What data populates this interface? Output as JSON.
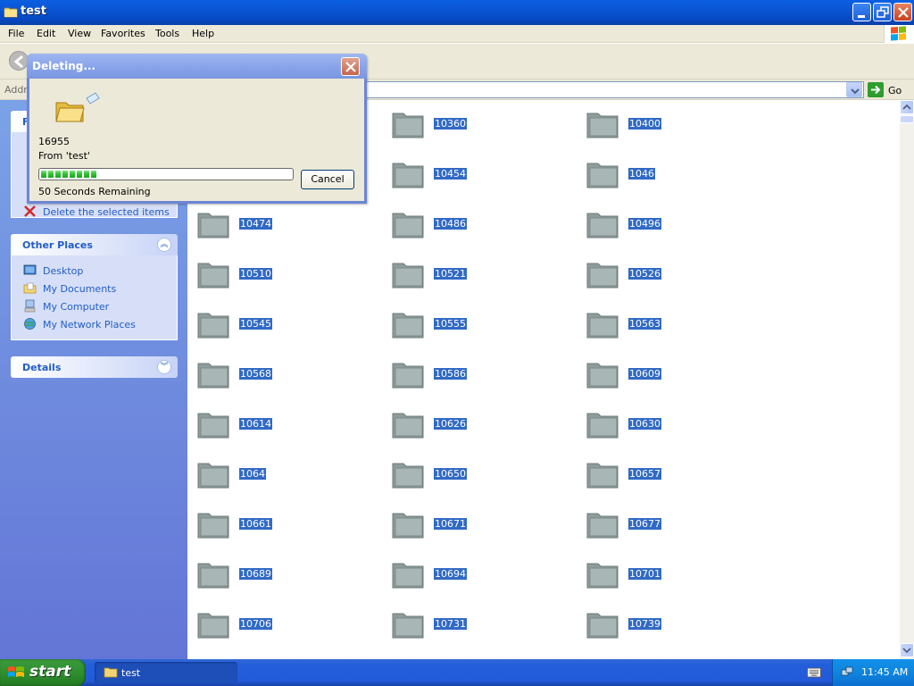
{
  "window": {
    "title": "test",
    "buttons": [
      "minimize",
      "maximize",
      "close"
    ]
  },
  "menu": {
    "items": [
      "File",
      "Edit",
      "View",
      "Favorites",
      "Tools",
      "Help"
    ]
  },
  "address": {
    "label": "Addre",
    "go_label": "Go"
  },
  "task_pane": {
    "file_tasks_partial": {
      "header_partial": "F",
      "hidden_item": "Delete the selected items"
    },
    "other_places": {
      "header": "Other Places",
      "items": [
        {
          "label": "Desktop",
          "icon": "desktop-icon"
        },
        {
          "label": "My Documents",
          "icon": "my-documents-icon"
        },
        {
          "label": "My Computer",
          "icon": "my-computer-icon"
        },
        {
          "label": "My Network Places",
          "icon": "network-places-icon"
        }
      ]
    },
    "details": {
      "header": "Details"
    }
  },
  "files": {
    "items": [
      {
        "name": "10360"
      },
      {
        "name": "10400"
      },
      {
        "name": "10454"
      },
      {
        "name": "1046"
      },
      {
        "name": "10474"
      },
      {
        "name": "10486"
      },
      {
        "name": "10496"
      },
      {
        "name": "10510"
      },
      {
        "name": "10521"
      },
      {
        "name": "10526"
      },
      {
        "name": "10545"
      },
      {
        "name": "10555"
      },
      {
        "name": "10563"
      },
      {
        "name": "10568"
      },
      {
        "name": "10586"
      },
      {
        "name": "10609"
      },
      {
        "name": "10614"
      },
      {
        "name": "10626"
      },
      {
        "name": "10630"
      },
      {
        "name": "1064"
      },
      {
        "name": "10650"
      },
      {
        "name": "10657"
      },
      {
        "name": "10661"
      },
      {
        "name": "10671"
      },
      {
        "name": "10677"
      },
      {
        "name": "10689"
      },
      {
        "name": "10694"
      },
      {
        "name": "10701"
      },
      {
        "name": "10706"
      },
      {
        "name": "10731"
      },
      {
        "name": "10739"
      }
    ]
  },
  "dialog": {
    "title": "Deleting...",
    "item_name": "16955",
    "from_text": "From 'test'",
    "progress_fraction": 0.22,
    "remaining_text": "50 Seconds Remaining",
    "cancel_label": "Cancel"
  },
  "taskbar": {
    "start_label": "start",
    "task_item_label": "test",
    "clock": "11:45 AM"
  },
  "colors": {
    "selection": "#316ac5",
    "titlebar": "#0b55d4",
    "taskpane_link": "#215dc6",
    "start_green": "#2f8f2f"
  }
}
